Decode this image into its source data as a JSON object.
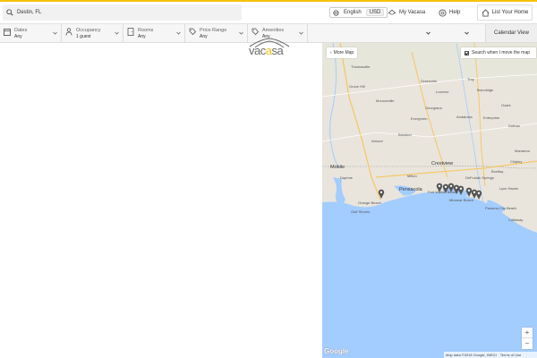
{
  "header": {
    "search_value": "Destin, FL",
    "language": "English",
    "currency": "USD",
    "my_vacasa": "My Vacasa",
    "help": "Help",
    "list_home": "List Your Home"
  },
  "filters": [
    {
      "label": "Dates",
      "value": "Any"
    },
    {
      "label": "Occupancy",
      "value": "1 guest"
    },
    {
      "label": "Rooms",
      "value": "Any"
    },
    {
      "label": "Price Range",
      "value": "Any"
    },
    {
      "label": "Amenities",
      "value": "Any"
    }
  ],
  "calendar_view": "Calendar View",
  "logo": {
    "text_a": "vac",
    "text_b": "a",
    "text_c": "sa"
  },
  "map": {
    "more_map": "More Map",
    "search_when_move": "Search when I move the map",
    "search_when_move_checked": true,
    "zoom_in": "+",
    "zoom_out": "−",
    "google": "Google",
    "attribution": "Map data ©2018 Google, INEGI",
    "terms": "Terms of Use",
    "land_color": "#e9e5dc",
    "water_color": "#a3ccff",
    "pin_color": "#555555",
    "towns": {
      "thomasville": "Thomasville",
      "grove_hill": "Grove Hill",
      "greenville": "Greenville",
      "troy": "Troy",
      "monroeville": "Monroeville",
      "evergreen": "Evergreen",
      "andalusia": "Andalusia",
      "enterprise": "Enterprise",
      "dothan": "Dothan",
      "ozark": "Ozark",
      "atmore": "Atmore",
      "brewton": "Brewton",
      "chipley": "Chipley",
      "crestview": "Crestview",
      "mobile": "Mobile",
      "pensacola": "Pensacola",
      "orange_beach": "Orange Beach",
      "gulf_shores": "Gulf Shores",
      "fort_walton": "Fort Walton Beach",
      "miramar": "Miramar Beach",
      "panama_city": "Panama City Beach",
      "callaway": "Callaway",
      "marianna": "Marianna",
      "georgiana": "Georgiana",
      "brundidge": "Brundidge",
      "luverne": "Luverne",
      "daphne": "Daphne",
      "milton": "Milton",
      "defuniak": "DeFuniak Springs",
      "bonifay": "Bonifay",
      "lynn_haven": "Lynn Haven"
    }
  }
}
